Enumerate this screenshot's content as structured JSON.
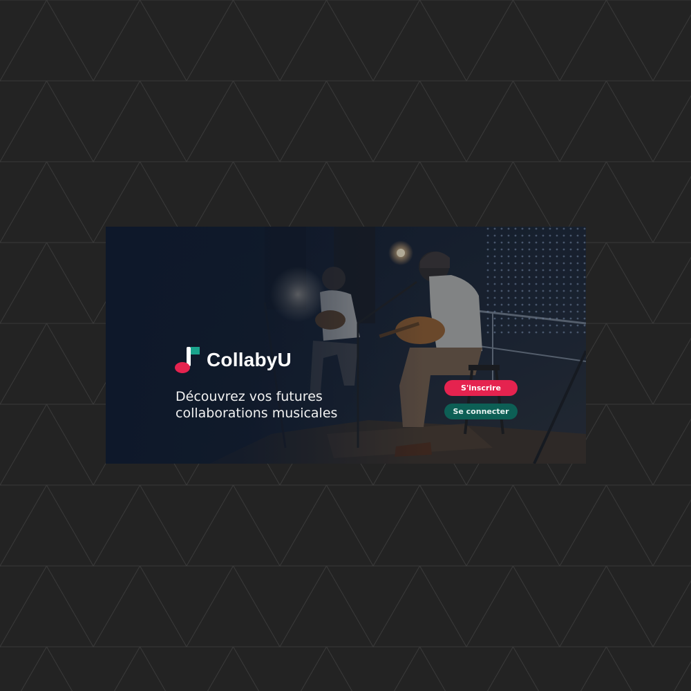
{
  "brand": {
    "name": "CollabyU",
    "colors": {
      "accent_pink": "#e5234f",
      "accent_teal": "#1aa38c",
      "secondary_button": "#0d5f55"
    }
  },
  "hero": {
    "tagline_line1": "Découvrez vos futures",
    "tagline_line2": "collaborations musicales"
  },
  "actions": {
    "signup_label": "S'inscrire",
    "login_label": "Se connecter"
  },
  "icons": [
    "music-note-logo-icon"
  ]
}
